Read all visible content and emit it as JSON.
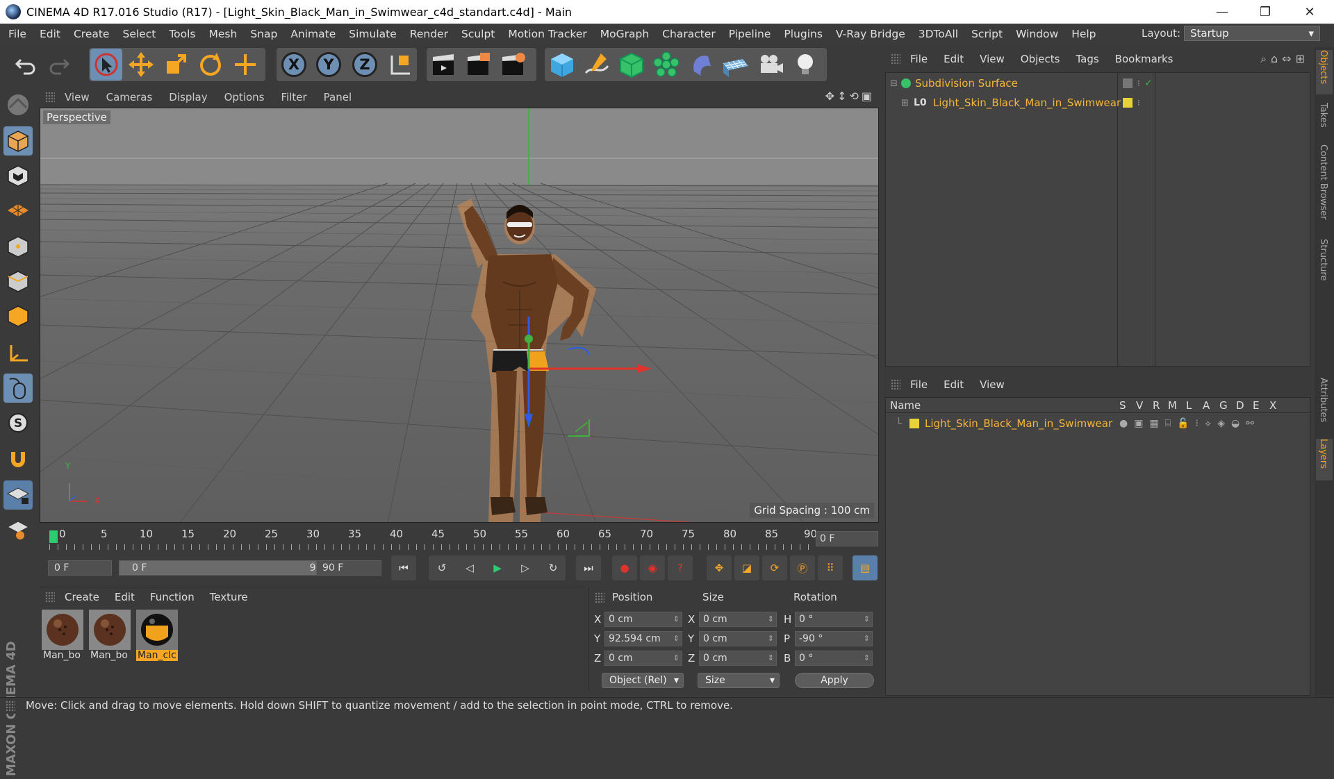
{
  "window": {
    "title": "CINEMA 4D R17.016 Studio (R17) - [Light_Skin_Black_Man_in_Swimwear_c4d_standart.c4d] - Main",
    "min": "—",
    "max": "❐",
    "close": "✕"
  },
  "menu": [
    "File",
    "Edit",
    "Create",
    "Select",
    "Tools",
    "Mesh",
    "Snap",
    "Animate",
    "Simulate",
    "Render",
    "Sculpt",
    "Motion Tracker",
    "MoGraph",
    "Character",
    "Pipeline",
    "Plugins",
    "V-Ray Bridge",
    "3DToAll",
    "Script",
    "Window",
    "Help"
  ],
  "layout": {
    "label": "Layout:",
    "value": "Startup"
  },
  "toolbar": {
    "axes": [
      "X",
      "Y",
      "Z"
    ]
  },
  "viewport": {
    "menu": [
      "View",
      "Cameras",
      "Display",
      "Options",
      "Filter",
      "Panel"
    ],
    "label": "Perspective",
    "grid_spacing": "Grid Spacing : 100 cm",
    "axis_y": "Y",
    "axis_x": "X",
    "colors": {
      "x_axis": "#e0332b",
      "y_axis": "#3fb33f",
      "z_axis": "#2a5ee8",
      "selection": "#f5a623"
    }
  },
  "timeline": {
    "ticks": [
      "0",
      "5",
      "10",
      "15",
      "20",
      "25",
      "30",
      "35",
      "40",
      "45",
      "50",
      "55",
      "60",
      "65",
      "70",
      "75",
      "80",
      "85",
      "90"
    ],
    "current": "0 F"
  },
  "transport": {
    "start": "0 F",
    "range_start": "0 F",
    "range_end": "90 F",
    "end": "90 F"
  },
  "materials": {
    "menu": [
      "Create",
      "Edit",
      "Function",
      "Texture"
    ],
    "items": [
      {
        "name": "Man_bo",
        "selected": false
      },
      {
        "name": "Man_bo",
        "selected": false
      },
      {
        "name": "Man_clc",
        "selected": true
      }
    ]
  },
  "coordinates": {
    "headers": {
      "position": "Position",
      "size": "Size",
      "rotation": "Rotation"
    },
    "rows": [
      {
        "pos_label": "X",
        "pos": "0 cm",
        "size_label": "X",
        "size": "0 cm",
        "rot_label": "H",
        "rot": "0 °"
      },
      {
        "pos_label": "Y",
        "pos": "92.594 cm",
        "size_label": "Y",
        "size": "0 cm",
        "rot_label": "P",
        "rot": "-90 °"
      },
      {
        "pos_label": "Z",
        "pos": "0 cm",
        "size_label": "Z",
        "size": "0 cm",
        "rot_label": "B",
        "rot": "0 °"
      }
    ],
    "mode": "Object (Rel)",
    "size_mode": "Size",
    "apply": "Apply"
  },
  "status": "Move: Click and drag to move elements. Hold down SHIFT to quantize movement / add to the selection in point mode, CTRL to remove.",
  "object_manager": {
    "menu": [
      "File",
      "Edit",
      "View",
      "Objects",
      "Tags",
      "Bookmarks"
    ],
    "objects": [
      {
        "name": "Subdivision Surface",
        "icon": "subdivision-icon"
      },
      {
        "name": "Light_Skin_Black_Man_in_Swimwear",
        "icon": "layer-null-icon",
        "prefix": "L0"
      }
    ]
  },
  "layer_manager": {
    "menu": [
      "File",
      "Edit",
      "View"
    ],
    "columns": [
      "Name",
      "S",
      "V",
      "R",
      "M",
      "L",
      "A",
      "G",
      "D",
      "E",
      "X"
    ],
    "layers": [
      {
        "name": "Light_Skin_Black_Man_in_Swimwear",
        "color": "#e8d23a"
      }
    ]
  },
  "right_tabs": [
    "Objects",
    "Takes",
    "Content Browser",
    "Structure",
    "Attributes",
    "Layers"
  ],
  "brand": "MAXON CINEMA 4D"
}
